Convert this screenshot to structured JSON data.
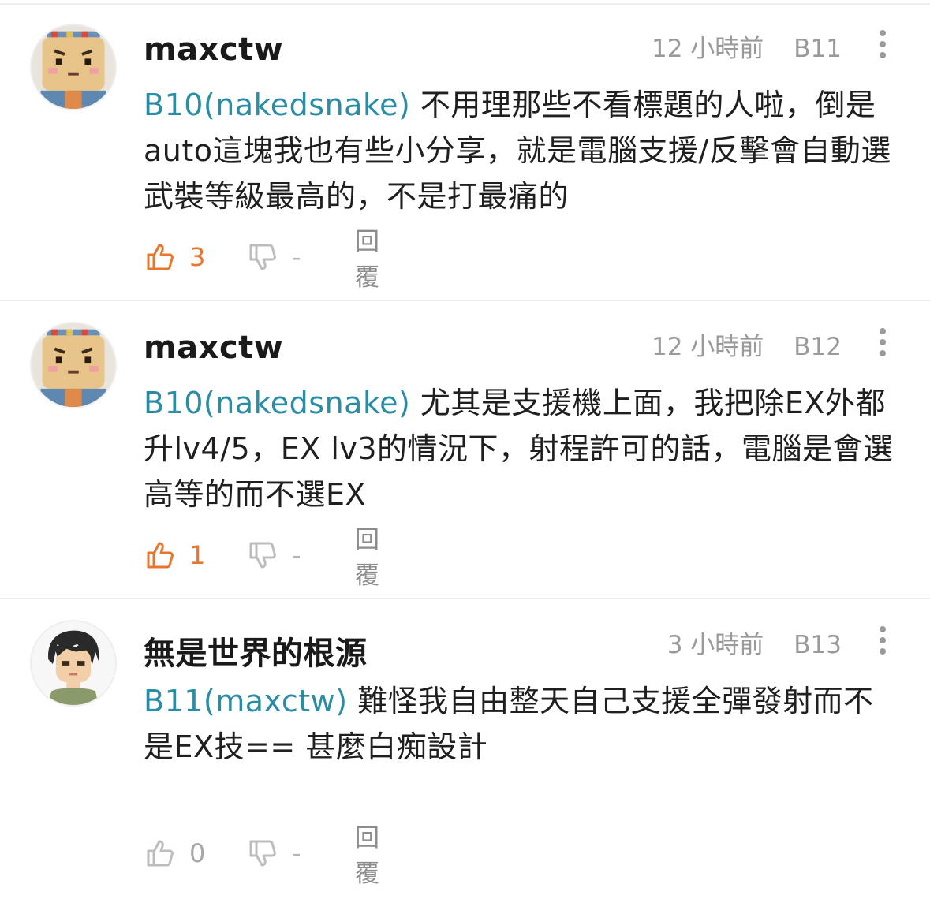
{
  "colors": {
    "mention": "#2a8da6",
    "like_active": "#e8762d",
    "muted": "#9a9a9a",
    "divider": "#eeeeee"
  },
  "comments": [
    {
      "username": "maxctw",
      "time": "12 小時前",
      "floor": "B11",
      "mention": "B10(nakedsnake)",
      "text": " 不用理那些不看標題的人啦，倒是auto這塊我也有些小分享，就是電腦支援/反擊會自動選武裝等級最高的，不是打最痛的",
      "likes": "3",
      "dislikes": "-",
      "reply_label": "回覆",
      "avatar_icon": "pixel-face-avatar-icon"
    },
    {
      "username": "maxctw",
      "time": "12 小時前",
      "floor": "B12",
      "mention": "B10(nakedsnake)",
      "text": " 尤其是支援機上面，我把除EX外都升lv4/5，EX lv3的情況下，射程許可的話，電腦是會選高等的而不選EX",
      "likes": "1",
      "dislikes": "-",
      "reply_label": "回覆",
      "avatar_icon": "pixel-face-avatar-icon"
    },
    {
      "username": "無是世界的根源",
      "time": "3 小時前",
      "floor": "B13",
      "mention": "B11(maxctw)",
      "text": " 難怪我自由整天自己支援全彈發射而不是EX技== 甚麼白痴設計",
      "likes": "0",
      "dislikes": "-",
      "reply_label": "回覆",
      "avatar_icon": "anime-character-avatar-icon"
    }
  ]
}
